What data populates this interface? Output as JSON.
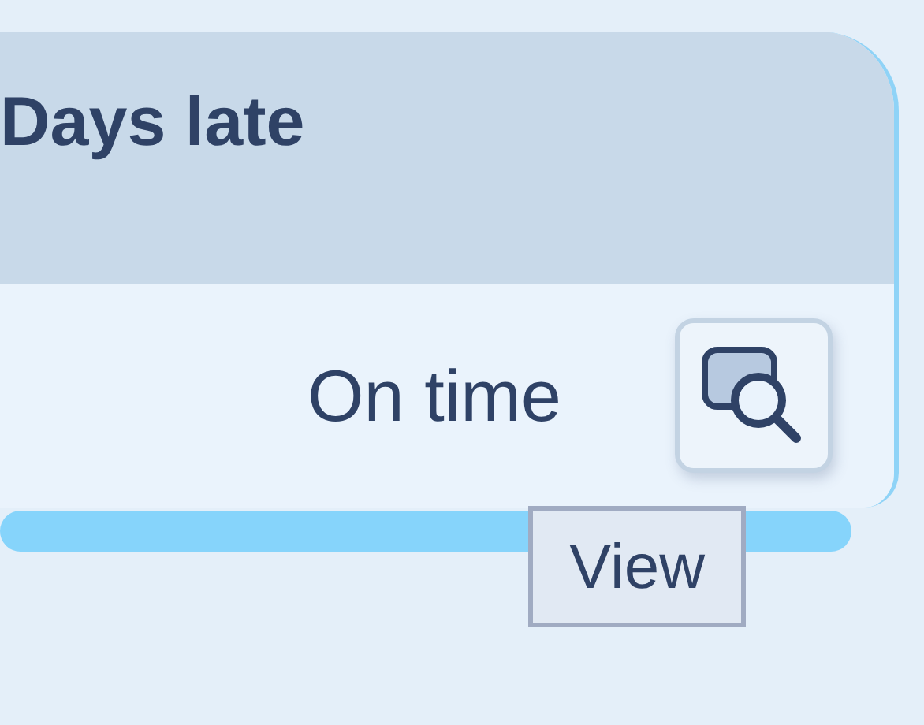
{
  "table": {
    "columns": [
      {
        "label": "Days late"
      }
    ],
    "rows": [
      {
        "days_late": "On time",
        "action": {
          "tooltip": "View"
        }
      }
    ]
  }
}
